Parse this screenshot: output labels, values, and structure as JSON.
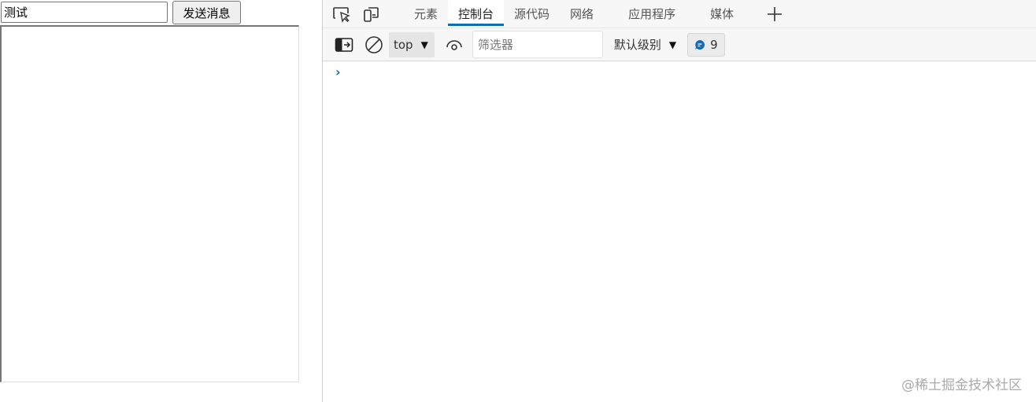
{
  "page": {
    "input_value": "测试",
    "send_label": "发送消息"
  },
  "devtools": {
    "tabs": [
      {
        "label": "元素"
      },
      {
        "label": "控制台"
      },
      {
        "label": "源代码"
      },
      {
        "label": "网络"
      },
      {
        "label": "应用程序"
      },
      {
        "label": "媒体"
      }
    ],
    "active_tab": "控制台",
    "context": "top",
    "filter_placeholder": "筛选器",
    "level": "默认级别",
    "message_count": "9",
    "prompt": "›"
  },
  "watermark": "@稀土掘金技术社区",
  "colors": {
    "accent": "#0f6cbd"
  }
}
